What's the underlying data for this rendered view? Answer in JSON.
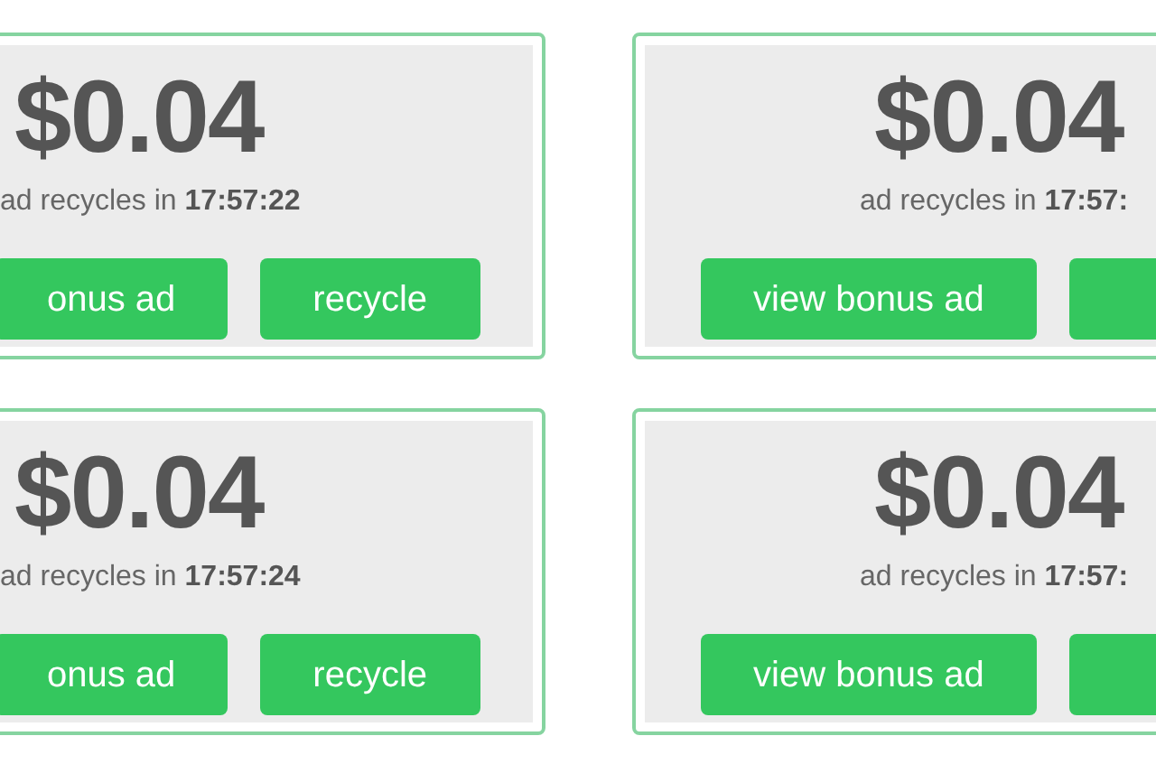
{
  "cards": [
    {
      "amount": "$0.04",
      "countdown": "ad recycles in **17:57:22**",
      "buttons": [
        {
          "kind": "text",
          "label": "onus ad"
        },
        {
          "kind": "text",
          "label": "recycle"
        }
      ]
    },
    {
      "amount": "$0.04",
      "countdown": "ad recycles in **17:57:**",
      "buttons": [
        {
          "kind": "text",
          "label": "view bonus ad"
        },
        {
          "kind": "blank"
        }
      ]
    },
    {
      "amount": "$0.04",
      "countdown": "ad recycles in **17:57:24**",
      "buttons": [
        {
          "kind": "text",
          "label": "onus ad"
        },
        {
          "kind": "text",
          "label": "recycle"
        }
      ]
    },
    {
      "amount": "$0.04",
      "countdown": "ad recycles in **17:57:**",
      "buttons": [
        {
          "kind": "text",
          "label": "view bonus ad"
        },
        {
          "kind": "blank"
        }
      ]
    }
  ]
}
